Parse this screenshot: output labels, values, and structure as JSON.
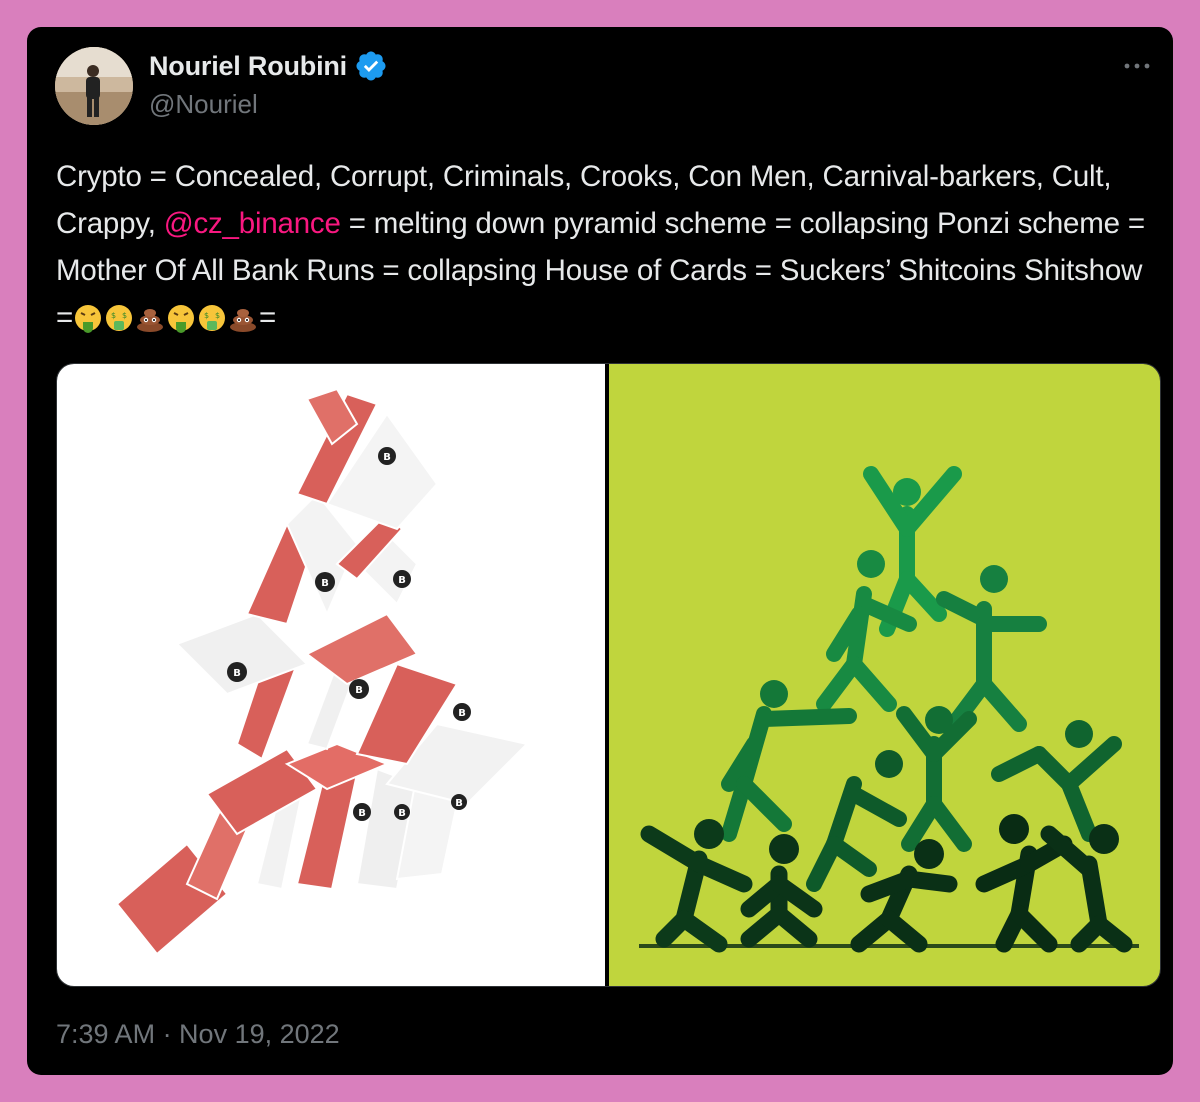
{
  "author": {
    "name": "Nouriel Roubini",
    "handle": "@Nouriel",
    "verified": true,
    "verified_icon": "verified-badge-icon",
    "avatar_icon": "avatar"
  },
  "menu_icon": "more-options-icon",
  "tweet": {
    "text_part1": "Crypto =  Concealed, Corrupt, Criminals, Crooks, Con Men, Carnival-barkers, Cult, Crappy, ",
    "mention": "@cz_binance",
    "text_part2": " = melting  down pyramid scheme = collapsing Ponzi scheme = Mother Of All Bank Runs = collapsing House of Cards = Suckers’ Shitcoins Shitshow =",
    "emojis": [
      "nauseated-face",
      "money-mouth-face",
      "pile-of-poo",
      "nauseated-face",
      "money-mouth-face",
      "pile-of-poo"
    ],
    "text_end": "="
  },
  "media": {
    "left_image": "house-of-cards-bitcoin-image",
    "right_image": "collapsing-human-pyramid-image"
  },
  "timestamp": "7:39 AM · Nov 19, 2022",
  "colors": {
    "background": "#d97fbd",
    "card": "#000000",
    "text": "#e7e9ea",
    "muted": "#71767b",
    "mention": "#f91880",
    "verified": "#1d9bf0",
    "pyramid_bg": "#c0d53d"
  }
}
